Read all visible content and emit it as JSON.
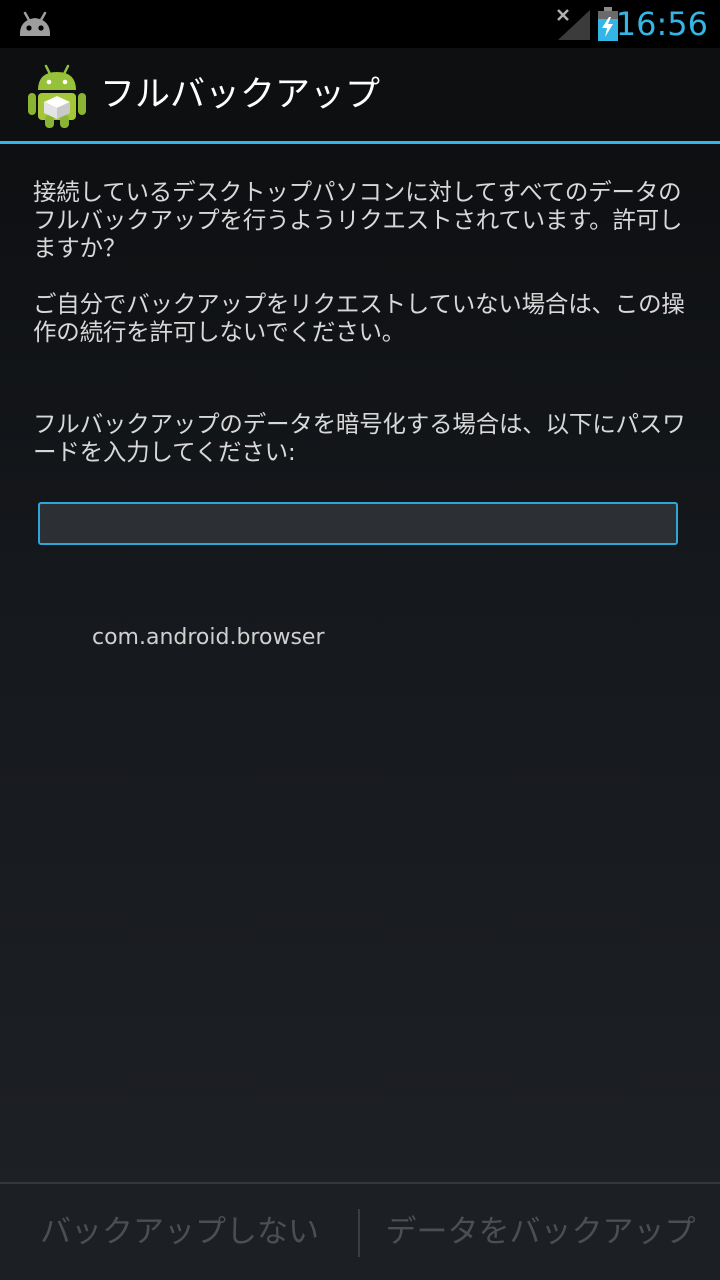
{
  "status_bar": {
    "time": "16:56",
    "notification_icon": "android-debug-icon",
    "signal_icon": "signal-no-service-icon",
    "battery_icon": "battery-charging-icon",
    "accent_color": "#33b5e5"
  },
  "action_bar": {
    "title": "フルバックアップ",
    "app_icon": "android-backup-icon"
  },
  "content": {
    "paragraph_1": "接続しているデスクトップパソコンに対してすべてのデータのフルバックアップを行うようリクエストされています。許可しますか？",
    "paragraph_2": "ご自分でバックアップをリクエストしていない場合は、この操作の続行を許可しないでください。",
    "paragraph_3": "フルバックアップのデータを暗号化する場合は、以下にパスワードを入力してください:",
    "password_value": "",
    "package_name": "com.android.browser"
  },
  "buttons": {
    "deny_label": "バックアップしない",
    "allow_label": "データをバックアップ"
  }
}
